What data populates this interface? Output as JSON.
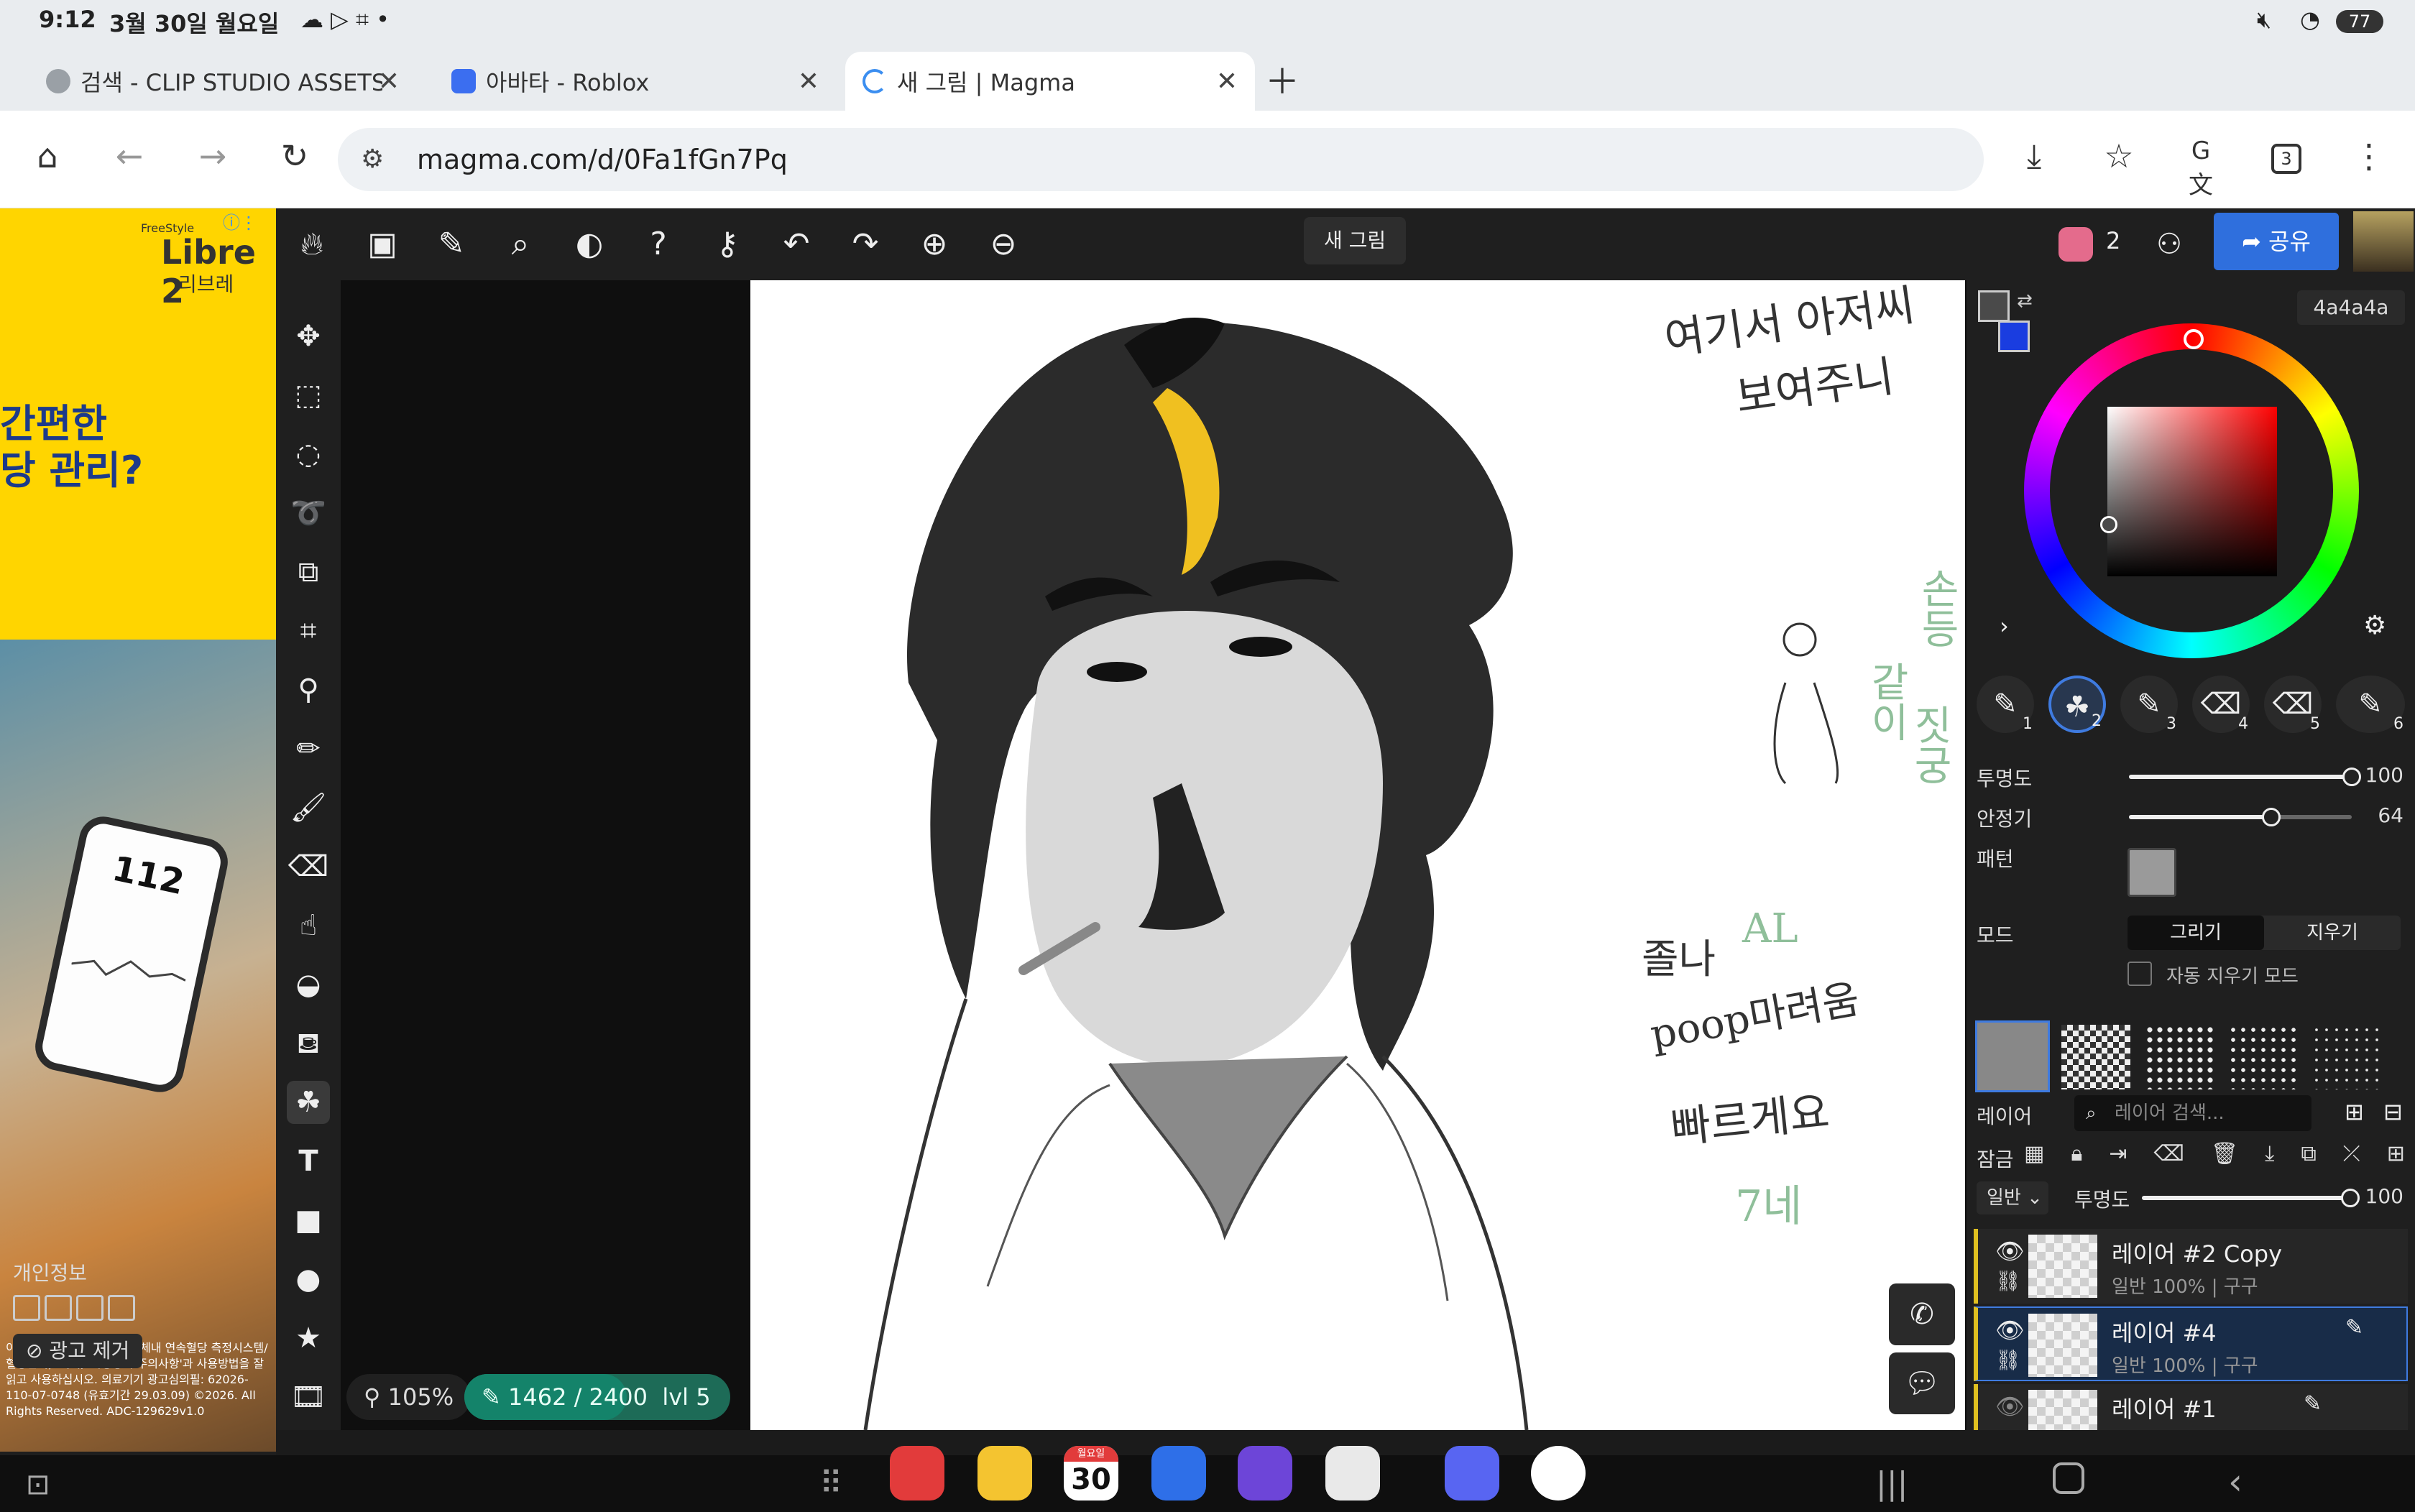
{
  "status_bar": {
    "time": "9:12",
    "date": "3월 30일 월요일",
    "battery": "77"
  },
  "tabs": [
    {
      "label": "검색 - CLIP STUDIO ASSETS",
      "fav_color": "#9aa0a6"
    },
    {
      "label": "아바타 - Roblox",
      "fav_color": "#3b6ef0"
    },
    {
      "label": "새 그림 | Magma",
      "fav_color": "#3b8ef0"
    }
  ],
  "omnibox": {
    "url": "magma.com/d/0Fa1fGn7Pq",
    "tab_count": "3"
  },
  "ad": {
    "brand_small": "FreeStyle",
    "brand": "Libre 2",
    "brand_sub": "리브레",
    "headline_1": "간편한",
    "headline_2": "당 관리?",
    "phone_value": "112",
    "fine_print": "이 제품은 '의료기기'(개인용체내 연속혈당 측정시스템/혈당관리)' 이며, '사용상의 주의사항'과 사용방법을 잘 읽고 사용하십시오. 의료기기 광고심의필: 62026-110-07-0748 (유효기간 29.03.09) ©2026. All Rights Reserved. ADC-129629v1.0",
    "privacy": "개인정보",
    "remove_ads": "광고 제거"
  },
  "app": {
    "doc_name": "새 그림",
    "user_count": "2",
    "share": "공유",
    "zoom": "105%",
    "xp": "1462 / 2400",
    "xp_fraction": 0.61,
    "level": "lvl 5"
  },
  "color": {
    "hex": "4a4a4a",
    "primary": "#4a4a4a",
    "secondary": "#1a3de0",
    "hue_color": "#ff0000"
  },
  "brush": {
    "buttons": [
      "1",
      "2",
      "3",
      "4",
      "5",
      "6"
    ],
    "opacity_label": "투명도",
    "opacity_value": "100",
    "opacity_fraction": 1.0,
    "stabilizer_label": "안정기",
    "stabilizer_value": "64",
    "stabilizer_fraction": 0.64,
    "pattern_label": "패턴",
    "mode_label": "모드",
    "mode_draw": "그리기",
    "mode_erase": "지우기",
    "auto_erase": "자동 지우기 모드"
  },
  "layers": {
    "title": "레이어",
    "search_placeholder": "레이어 검색...",
    "lock_label": "잠금",
    "blend": "일반",
    "opacity_label": "투명도",
    "opacity_value": "100",
    "opacity_fraction": 1.0,
    "items": [
      {
        "name": "레이어 #2 Copy",
        "sub": "일반 100% | 구구"
      },
      {
        "name": "레이어 #4",
        "sub": "일반 100% | 구구"
      },
      {
        "name": "레이어 #1",
        "sub": ""
      }
    ]
  },
  "sketch_text": {
    "t1": "여기서 아저씨",
    "t2": "보여주니",
    "t3": "손등",
    "t4": "같이",
    "t5": "짓궁",
    "t6": "졸나",
    "t7": "poop마려움",
    "t8": "빠르게요",
    "t9": "7네",
    "t10": "AL"
  },
  "dock": {
    "calendar_day": "30",
    "calendar_weekday": "월요일"
  }
}
